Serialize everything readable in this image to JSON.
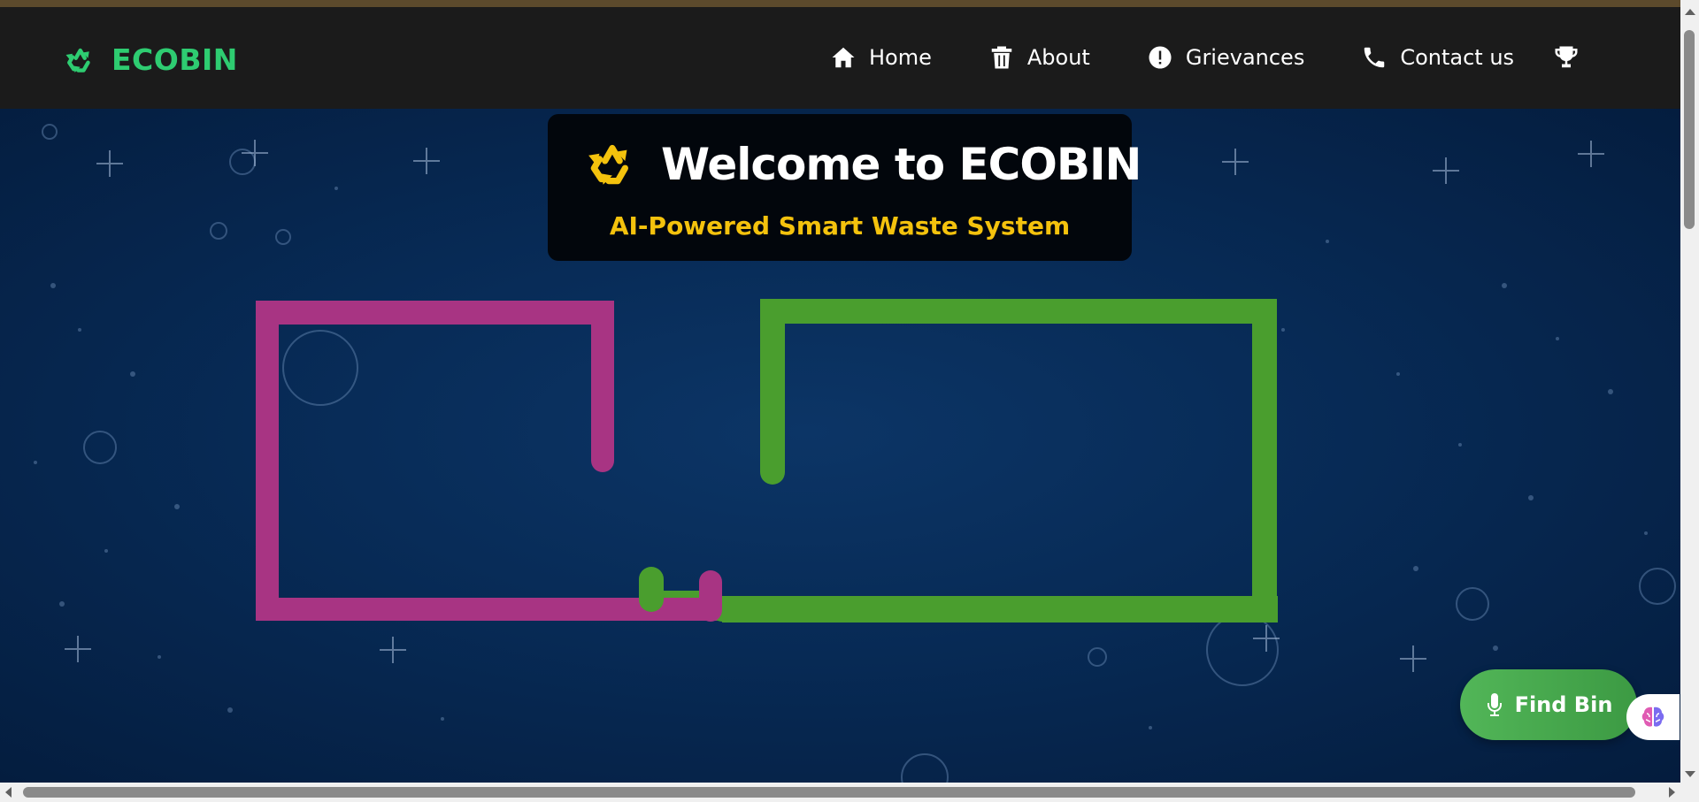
{
  "brand": {
    "name": "ECOBIN",
    "icon": "recycle-icon",
    "color": "#2ecc71"
  },
  "nav": {
    "items": [
      {
        "label": "Home",
        "icon": "home-icon"
      },
      {
        "label": "About",
        "icon": "trash-icon"
      },
      {
        "label": "Grievances",
        "icon": "exclamation-circle-icon"
      },
      {
        "label": "Contact us",
        "icon": "phone-icon"
      }
    ],
    "trophy_icon": "trophy-icon"
  },
  "hero": {
    "title": "Welcome to ECOBIN",
    "subtitle": "AI-Powered Smart Waste System",
    "subtitle_color": "#f4c20d",
    "pink_color": "#a83483",
    "green_color": "#4a9e2e"
  },
  "find_bin": {
    "label": "Find Bin",
    "icon": "microphone-icon"
  },
  "assistant": {
    "icon": "brain-icon"
  }
}
